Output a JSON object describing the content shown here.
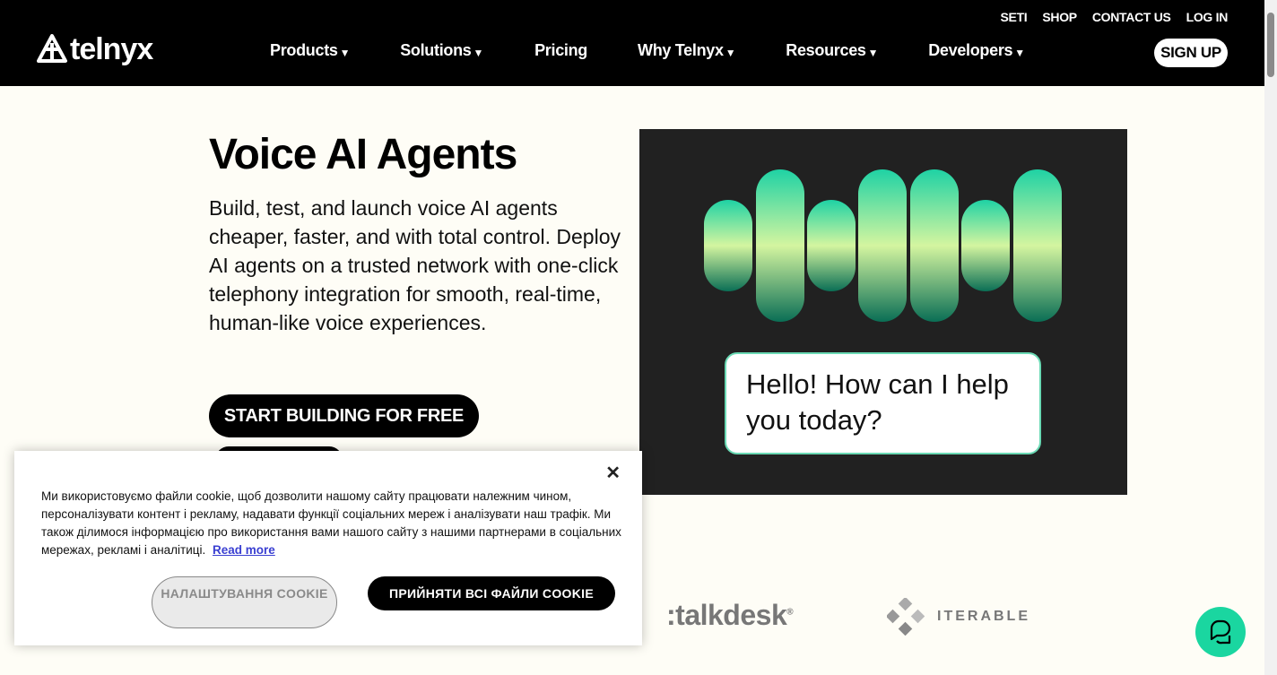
{
  "header": {
    "logo_text": "telnyx",
    "utility_links": [
      "SETI",
      "SHOP",
      "CONTACT US",
      "LOG IN"
    ],
    "nav": [
      {
        "label": "Products",
        "dropdown": true
      },
      {
        "label": "Solutions",
        "dropdown": true
      },
      {
        "label": "Pricing",
        "dropdown": false
      },
      {
        "label": "Why Telnyx",
        "dropdown": true
      },
      {
        "label": "Resources",
        "dropdown": true
      },
      {
        "label": "Developers",
        "dropdown": true
      }
    ],
    "caret": "▼",
    "signup_label": "SIGN UP"
  },
  "hero": {
    "title": "Voice AI Agents",
    "description": "Build, test, and launch voice AI agents cheaper, faster, and with total control. Deploy AI agents on a trusted network with one-click telephony integration for smooth, real-time, human-like voice experiences.",
    "cta_label": "START BUILDING FOR FREE",
    "bubble_text": "Hello! How can I help you today?",
    "wave_levels": [
      0.6,
      1.0,
      0.6,
      1.0,
      1.0,
      0.6,
      1.0
    ]
  },
  "logos": {
    "talkdesk": ":talkdesk",
    "talkdesk_mark": "®",
    "iterable": "ITERABLE"
  },
  "cookie_banner": {
    "close_label": "✕",
    "text": "Ми використовуємо файли cookie, щоб дозволити нашому сайту працювати належним чином, персоналізувати контент і рекламу, надавати функції соціальних мереж і аналізувати наш трафік. Ми також ділимося інформацією про використання вами нашого сайту з нашими партнерами в соціальних мережах, рекламі і аналітиці.",
    "read_more": "Read more",
    "settings_label": "НАЛАШТУВАННЯ COOKIE",
    "accept_label": "ПРИЙНЯТИ ВСІ ФАЙЛИ COOKIE"
  },
  "colors": {
    "header_bg": "#000000",
    "page_bg": "#fefdf6",
    "accent_green": "#1ad6a0",
    "media_bg": "#212121",
    "link_blue": "#3a3fd1"
  }
}
